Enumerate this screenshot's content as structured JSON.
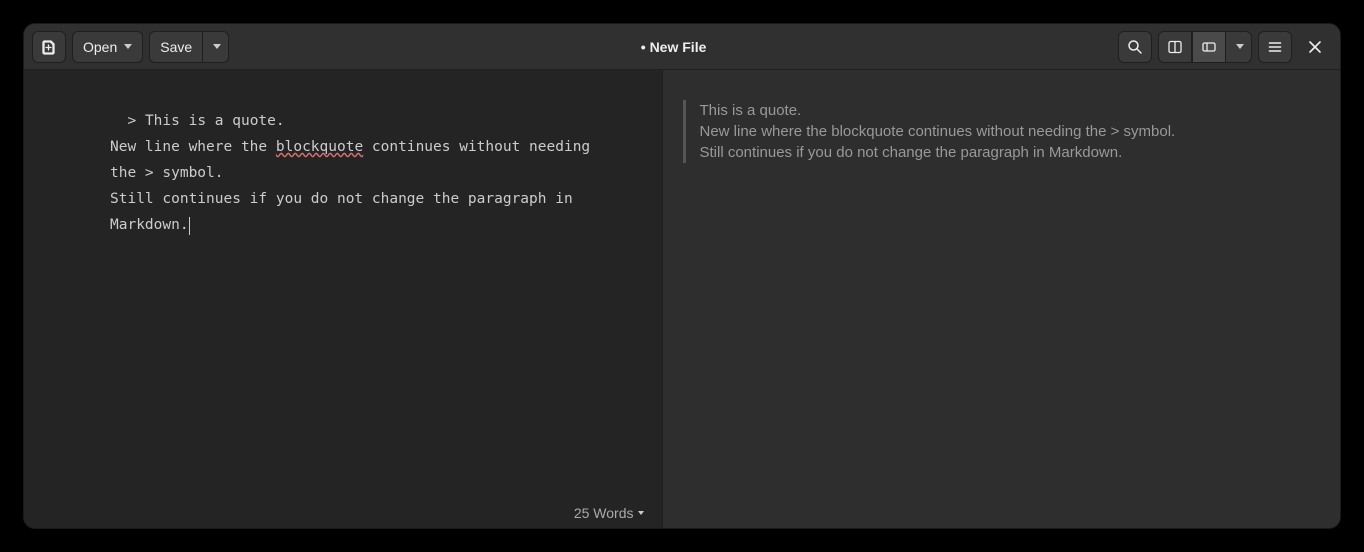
{
  "toolbar": {
    "open_label": "Open",
    "save_label": "Save"
  },
  "title": "• New File",
  "editor": {
    "line1_prefix": "  > ",
    "line1_text": "This is a quote.",
    "line2_a": "New line where the ",
    "line2_err": "blockquote",
    "line2_b": " continues without needing the > symbol.",
    "line3": "Still continues if you do not change the paragraph in Markdown."
  },
  "preview": {
    "quote_line1": "This is a quote.",
    "quote_line2": "New line where the blockquote continues without needing the > symbol.",
    "quote_line3": "Still continues if you do not change the paragraph in Markdown."
  },
  "status": {
    "word_count_label": "25 Words"
  }
}
